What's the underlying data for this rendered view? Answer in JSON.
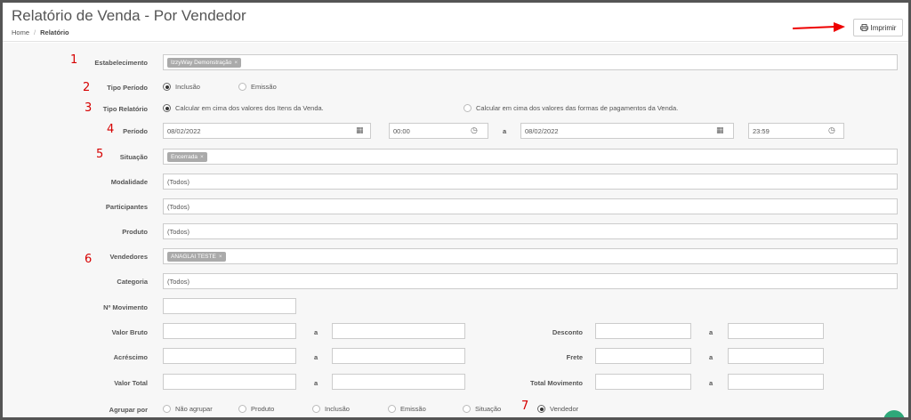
{
  "header": {
    "title": "Relatório de Venda - Por Vendedor",
    "breadcrumb_home": "Home",
    "breadcrumb_sep": "/",
    "breadcrumb_current": "Relatório",
    "print_label": "Imprimir",
    "print_icon": "printer-icon"
  },
  "annotations": [
    "1",
    "2",
    "3",
    "4",
    "5",
    "6",
    "7"
  ],
  "form": {
    "estabelecimento": {
      "label": "Estabelecimento",
      "tag": "IzzyWay Demonstração",
      "remove": "×"
    },
    "tipo_periodo": {
      "label": "Tipo Período",
      "options": [
        "Inclusão",
        "Emissão"
      ],
      "selected": "Inclusão"
    },
    "tipo_relatorio": {
      "label": "Tipo Relatório",
      "options": [
        "Calcular em cima dos valores dos Itens da Venda.",
        "Calcular em cima dos valores das formas de pagamentos da Venda."
      ],
      "selected": "Calcular em cima dos valores dos Itens da Venda."
    },
    "periodo": {
      "label": "Período",
      "start_date": "08/02/2022",
      "start_time": "00:00",
      "to": "a",
      "end_date": "08/02/2022",
      "end_time": "23:59",
      "calendar_icon": "▦",
      "clock_icon": "◷"
    },
    "situacao": {
      "label": "Situação",
      "tag": "Encerrada",
      "remove": "×"
    },
    "modalidade": {
      "label": "Modalidade",
      "value": "(Todos)"
    },
    "participantes": {
      "label": "Participantes",
      "value": "(Todos)"
    },
    "produto": {
      "label": "Produto",
      "value": "(Todos)"
    },
    "vendedores": {
      "label": "Vendedores",
      "tag": "ANAGLAI TESTE",
      "remove": "×"
    },
    "categoria": {
      "label": "Categoria",
      "value": "(Todos)"
    },
    "n_movimento": {
      "label": "Nº Movimento"
    },
    "valor_bruto": {
      "label": "Valor Bruto",
      "to": "a"
    },
    "desconto": {
      "label": "Desconto",
      "to": "a"
    },
    "acrescimo": {
      "label": "Acréscimo",
      "to": "a"
    },
    "frete": {
      "label": "Frete",
      "to": "a"
    },
    "valor_total": {
      "label": "Valor Total",
      "to": "a"
    },
    "total_movimento": {
      "label": "Total Movimento",
      "to": "a"
    },
    "agrupar_por": {
      "label": "Agrupar por",
      "options": [
        "Não agrupar",
        "Produto",
        "Inclusão",
        "Emissão",
        "Situação",
        "Vendedor"
      ],
      "selected": "Vendedor"
    }
  }
}
